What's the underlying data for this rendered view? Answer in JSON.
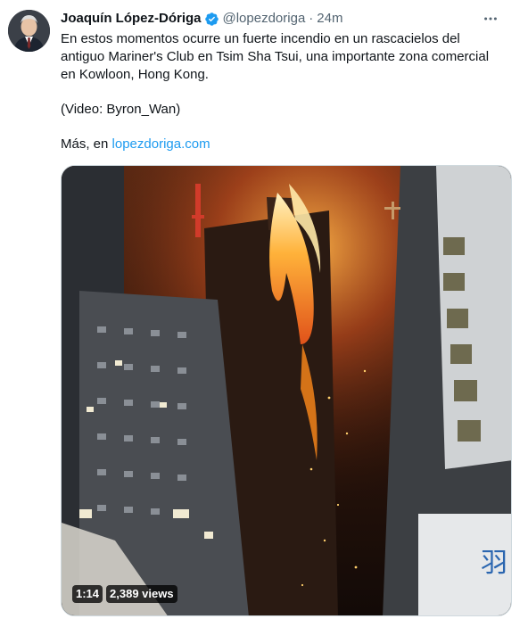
{
  "author": {
    "name": "Joaquín López-Dóriga",
    "handle": "@lopezdoriga",
    "separator": "·",
    "time": "24m",
    "verified": true
  },
  "tweet": {
    "line1": "En estos momentos ocurre un fuerte incendio en un rascacielos del",
    "line2": "antiguo Mariner's Club en Tsim Sha Tsui, una importante zona comercial",
    "line3": "en Kowloon, Hong Kong.",
    "credit": "(Video: Byron_Wan)",
    "more_prefix": "Más, en ",
    "more_link": "lopezdoriga.com"
  },
  "video": {
    "duration": "1:14",
    "views": "2,389 views"
  },
  "colors": {
    "link": "#1d9bf0",
    "verified": "#1d9bf0",
    "secondary_text": "#536471",
    "fire": "#ff8a1a"
  },
  "icons": {
    "verified": "verified-badge-icon",
    "more": "more-options-icon"
  }
}
